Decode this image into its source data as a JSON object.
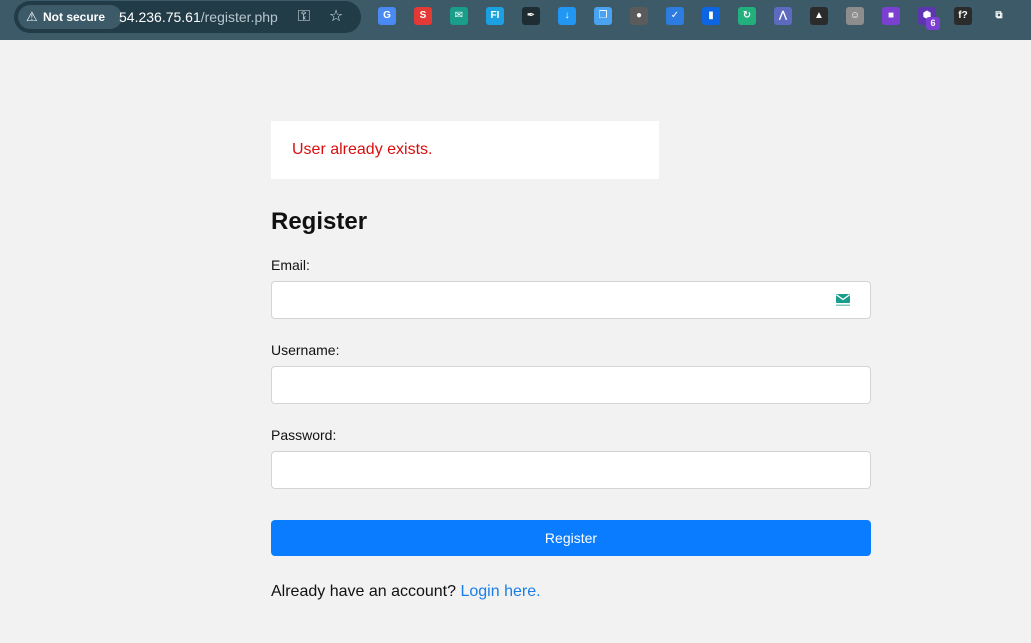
{
  "browser": {
    "security_label": "Not secure",
    "url_host": "54.236.75.61",
    "url_path": "/register.php",
    "extension_badge": "6",
    "extensions": [
      {
        "name": "translate-extension-icon",
        "color": "#4a8af4",
        "glyph": "G"
      },
      {
        "name": "red-circle-extension-icon",
        "color": "#e53935",
        "glyph": "S"
      },
      {
        "name": "mail-extension-icon",
        "color": "#1a9e8c",
        "glyph": "✉"
      },
      {
        "name": "fi-extension-icon",
        "color": "#1ba0e2",
        "glyph": "FI"
      },
      {
        "name": "eyedropper-extension-icon",
        "color": "#1f2d33",
        "glyph": "✒"
      },
      {
        "name": "download-extension-icon",
        "color": "#2196f3",
        "glyph": "↓"
      },
      {
        "name": "copy-extension-icon",
        "color": "#4aa3f0",
        "glyph": "❐"
      },
      {
        "name": "gray-extension-icon",
        "color": "#5b5b5b",
        "glyph": "●"
      },
      {
        "name": "file-check-extension-icon",
        "color": "#2d7de0",
        "glyph": "✓"
      },
      {
        "name": "trello-extension-icon",
        "color": "#0c66e4",
        "glyph": "▮"
      },
      {
        "name": "sync-extension-icon",
        "color": "#22b07d",
        "glyph": "↻"
      },
      {
        "name": "share-extension-icon",
        "color": "#5c6bc0",
        "glyph": "⋀"
      },
      {
        "name": "cap-extension-icon",
        "color": "#2b2b2b",
        "glyph": "▲"
      },
      {
        "name": "face-extension-icon",
        "color": "#8d8d8d",
        "glyph": "☺"
      },
      {
        "name": "purple-extension-icon",
        "color": "#7b3fd1",
        "glyph": "■"
      },
      {
        "name": "hexagon-extension-icon",
        "color": "#5e35b1",
        "glyph": "⬢"
      },
      {
        "name": "font-extension-icon",
        "color": "#2b2b2b",
        "glyph": "f?"
      },
      {
        "name": "puzzle-extension-icon",
        "color": "#3c5a68",
        "glyph": "⧉"
      }
    ]
  },
  "alert": {
    "message": "User already exists."
  },
  "form": {
    "title": "Register",
    "email_label": "Email:",
    "email_value": "",
    "username_label": "Username:",
    "username_value": "",
    "password_label": "Password:",
    "password_value": "",
    "submit_label": "Register"
  },
  "footer": {
    "prompt": "Already have an account? ",
    "login_link": "Login here."
  },
  "colors": {
    "page_background": "#f2f2f2",
    "primary_button": "#0a7cff",
    "error_text": "#d70f0f",
    "link": "#1a7ee6"
  }
}
